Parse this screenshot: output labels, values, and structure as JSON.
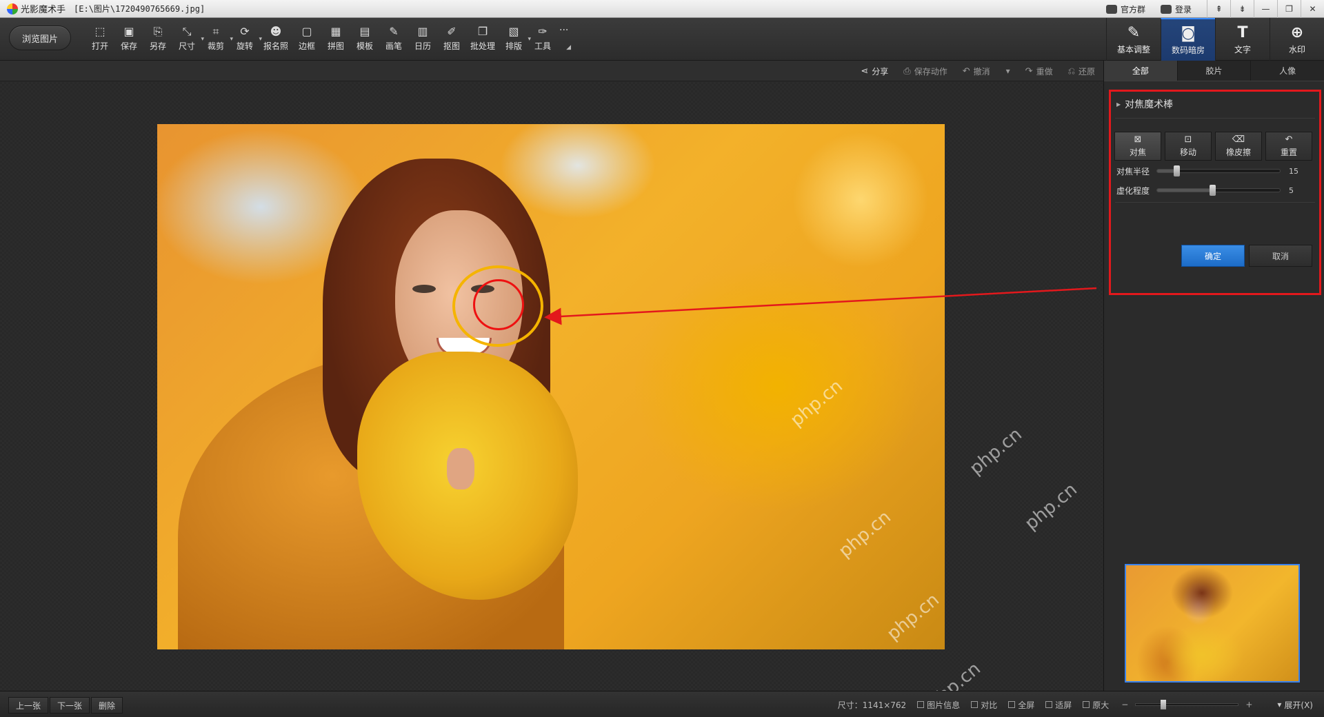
{
  "titlebar": {
    "app_name": "光影魔术手",
    "document": "[E:\\图片\\1720490765669.jpg]",
    "links": [
      "官方群",
      "登录"
    ],
    "window_buttons": [
      "⇞",
      "⇟",
      "—",
      "❐",
      "✕"
    ]
  },
  "toolbar": {
    "browse_label": "浏览图片",
    "tools": [
      {
        "label": "打开",
        "icon": "open-icon",
        "glyph": "⬚",
        "drop": false
      },
      {
        "label": "保存",
        "icon": "save-icon",
        "glyph": "▣",
        "drop": false
      },
      {
        "label": "另存",
        "icon": "save-as-icon",
        "glyph": "⎘",
        "drop": false
      },
      {
        "label": "尺寸",
        "icon": "resize-icon",
        "glyph": "⤡",
        "drop": true
      },
      {
        "label": "裁剪",
        "icon": "crop-icon",
        "glyph": "⌗",
        "drop": true
      },
      {
        "label": "旋转",
        "icon": "rotate-icon",
        "glyph": "⟳",
        "drop": true
      },
      {
        "label": "报名照",
        "icon": "id-photo-icon",
        "glyph": "☻",
        "drop": false
      },
      {
        "label": "边框",
        "icon": "border-icon",
        "glyph": "▢",
        "drop": false
      },
      {
        "label": "拼图",
        "icon": "collage-icon",
        "glyph": "▦",
        "drop": false
      },
      {
        "label": "模板",
        "icon": "template-icon",
        "glyph": "▤",
        "drop": false
      },
      {
        "label": "画笔",
        "icon": "brush-icon",
        "glyph": "✎",
        "drop": false
      },
      {
        "label": "日历",
        "icon": "calendar-icon",
        "glyph": "▥",
        "drop": false
      },
      {
        "label": "抠图",
        "icon": "cutout-icon",
        "glyph": "✐",
        "drop": false
      },
      {
        "label": "批处理",
        "icon": "batch-icon",
        "glyph": "❐",
        "drop": false
      },
      {
        "label": "排版",
        "icon": "layout-icon",
        "glyph": "▧",
        "drop": true
      },
      {
        "label": "工具",
        "icon": "tools-icon",
        "glyph": "✑",
        "drop": false
      }
    ],
    "more_glyph": "···",
    "modes": [
      {
        "label": "基本调整",
        "icon": "basic-adjust-icon",
        "glyph": "✎",
        "active": false
      },
      {
        "label": "数码暗房",
        "icon": "darkroom-icon",
        "glyph": "◙",
        "active": true
      },
      {
        "label": "文字",
        "icon": "text-icon",
        "glyph": "T",
        "active": false
      },
      {
        "label": "水印",
        "icon": "watermark-icon",
        "glyph": "⊕",
        "active": false
      }
    ]
  },
  "actionbar": {
    "items": [
      {
        "label": "分享",
        "icon": "share-icon",
        "glyph": "⋖",
        "enabled": true
      },
      {
        "label": "保存动作",
        "icon": "save-action-icon",
        "glyph": "⎙",
        "enabled": false
      },
      {
        "label": "撤消",
        "icon": "undo-icon",
        "glyph": "↶",
        "enabled": false
      },
      {
        "label": "重做",
        "icon": "redo-icon",
        "glyph": "↷",
        "enabled": false
      },
      {
        "label": "还原",
        "icon": "restore-icon",
        "glyph": "⎌",
        "enabled": false
      }
    ],
    "undo_dropdown": "▾"
  },
  "panel": {
    "tabs": [
      {
        "label": "全部",
        "active": true
      },
      {
        "label": "胶片",
        "active": false
      },
      {
        "label": "人像",
        "active": false
      }
    ],
    "effect": {
      "title": "对焦魔术棒",
      "buttons": [
        {
          "label": "对焦",
          "icon": "focus-icon",
          "glyph": "⊠",
          "active": true
        },
        {
          "label": "移动",
          "icon": "move-icon",
          "glyph": "⊡",
          "active": false
        },
        {
          "label": "橡皮擦",
          "icon": "eraser-icon",
          "glyph": "⌫",
          "active": false
        },
        {
          "label": "重置",
          "icon": "reset-icon",
          "glyph": "↶",
          "active": false
        }
      ],
      "sliders": [
        {
          "label": "对焦半径",
          "value": 15,
          "position": 0.16
        },
        {
          "label": "虚化程度",
          "value": 5,
          "position": 0.45
        }
      ],
      "ok_label": "确定",
      "cancel_label": "取消"
    }
  },
  "statusbar": {
    "nav": [
      "上一张",
      "下一张",
      "删除"
    ],
    "size_text": "尺寸：1141×762",
    "items": [
      {
        "label": "图片信息",
        "icon": "info-icon"
      },
      {
        "label": "对比",
        "icon": "compare-icon"
      },
      {
        "label": "全屏",
        "icon": "fullscreen-icon"
      },
      {
        "label": "适屏",
        "icon": "fit-screen-icon"
      },
      {
        "label": "原大",
        "icon": "actual-size-icon"
      }
    ],
    "zoom_minus": "−",
    "zoom_plus": "+",
    "zoom_position": 0.27,
    "expand_label": "展开(X)"
  },
  "watermark_text": "php.cn",
  "colors": {
    "accent": "#1d6cc8",
    "highlight_box": "#e3181c",
    "focus_ring": "#f5b400"
  }
}
